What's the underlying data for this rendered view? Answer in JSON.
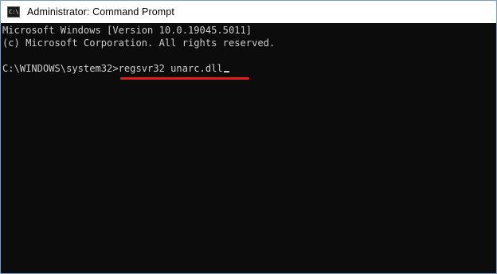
{
  "window": {
    "title": "Administrator: Command Prompt",
    "icon_glyph": "C:\\",
    "icon": "cmd-icon"
  },
  "console": {
    "lines": [
      "Microsoft Windows [Version 10.0.19045.5011]",
      "(c) Microsoft Corporation. All rights reserved."
    ],
    "prompt": "C:\\WINDOWS\\system32>",
    "command": "regsvr32 unarc.dll"
  },
  "annotation": {
    "underline_color": "#e0201c"
  },
  "colors": {
    "console_bg": "#0c0c0c",
    "console_text": "#cccccc",
    "titlebar_bg": "#ffffff"
  }
}
